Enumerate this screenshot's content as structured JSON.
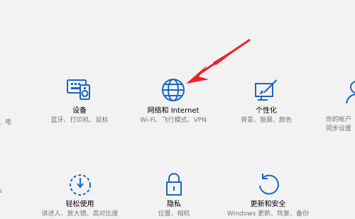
{
  "colors": {
    "accent": "#1a67c0",
    "arrow": "#ee1f2a",
    "background": "#f2f2f2"
  },
  "tiles": {
    "left_top": {
      "desc": "、电"
    },
    "devices": {
      "title": "设备",
      "desc": "蓝牙、打印机、鼠标",
      "icon": "devices-icon"
    },
    "network": {
      "title": "网络和 Internet",
      "desc": "Wi-Fi、飞行模式、VPN",
      "icon": "globe-icon"
    },
    "personalization": {
      "title": "个性化",
      "desc": "背景、锁屏、颜色",
      "icon": "personalization-icon"
    },
    "accounts_partial": {
      "desc_line1": "你的帐户",
      "desc_line2": "同步设置"
    },
    "left_bottom": {
      "desc": "s"
    },
    "ease_of_access": {
      "title": "轻松使用",
      "desc": "讲述人、放大镜、高对比度",
      "icon": "ease-of-access-icon"
    },
    "privacy": {
      "title": "隐私",
      "desc": "位置、相机",
      "icon": "lock-icon"
    },
    "update": {
      "title": "更新和安全",
      "desc": "Windows 更新、恢复、备份",
      "icon": "refresh-icon"
    }
  }
}
